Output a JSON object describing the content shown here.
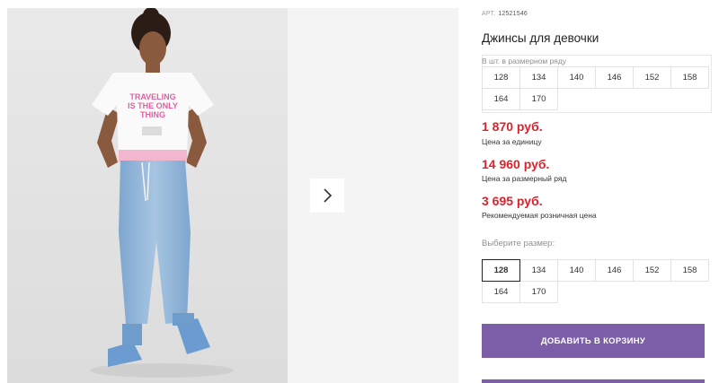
{
  "product": {
    "article_label": "АРТ.",
    "article_value": "12521546",
    "title": "Джинсы для девочки"
  },
  "photo": {
    "shirt_text_line1": "TRAVELING",
    "shirt_text_line2": "IS THE ONLY",
    "shirt_text_line3": "THING"
  },
  "size_row": {
    "label": "В шт. в размерном ряду",
    "sizes": [
      "128",
      "134",
      "140",
      "146",
      "152",
      "158",
      "164",
      "170"
    ]
  },
  "prices": {
    "unit_price": "1 870 руб.",
    "unit_label": "Цена за единицу",
    "row_price": "14 960 руб.",
    "row_label": "Цена за размерный ряд",
    "retail_price": "3 695 руб.",
    "retail_label": "Рекомендуемая розничная цена"
  },
  "size_select": {
    "label": "Выберите размер:",
    "sizes": [
      "128",
      "134",
      "140",
      "146",
      "152",
      "158",
      "164",
      "170"
    ],
    "selected": "128"
  },
  "actions": {
    "add_to_cart": "ДОБАВИТЬ В КОРЗИНУ"
  },
  "colors": {
    "accent": "#7b5ea7",
    "price": "#d9232d"
  },
  "icons": {
    "next": "chevron-right-icon"
  }
}
